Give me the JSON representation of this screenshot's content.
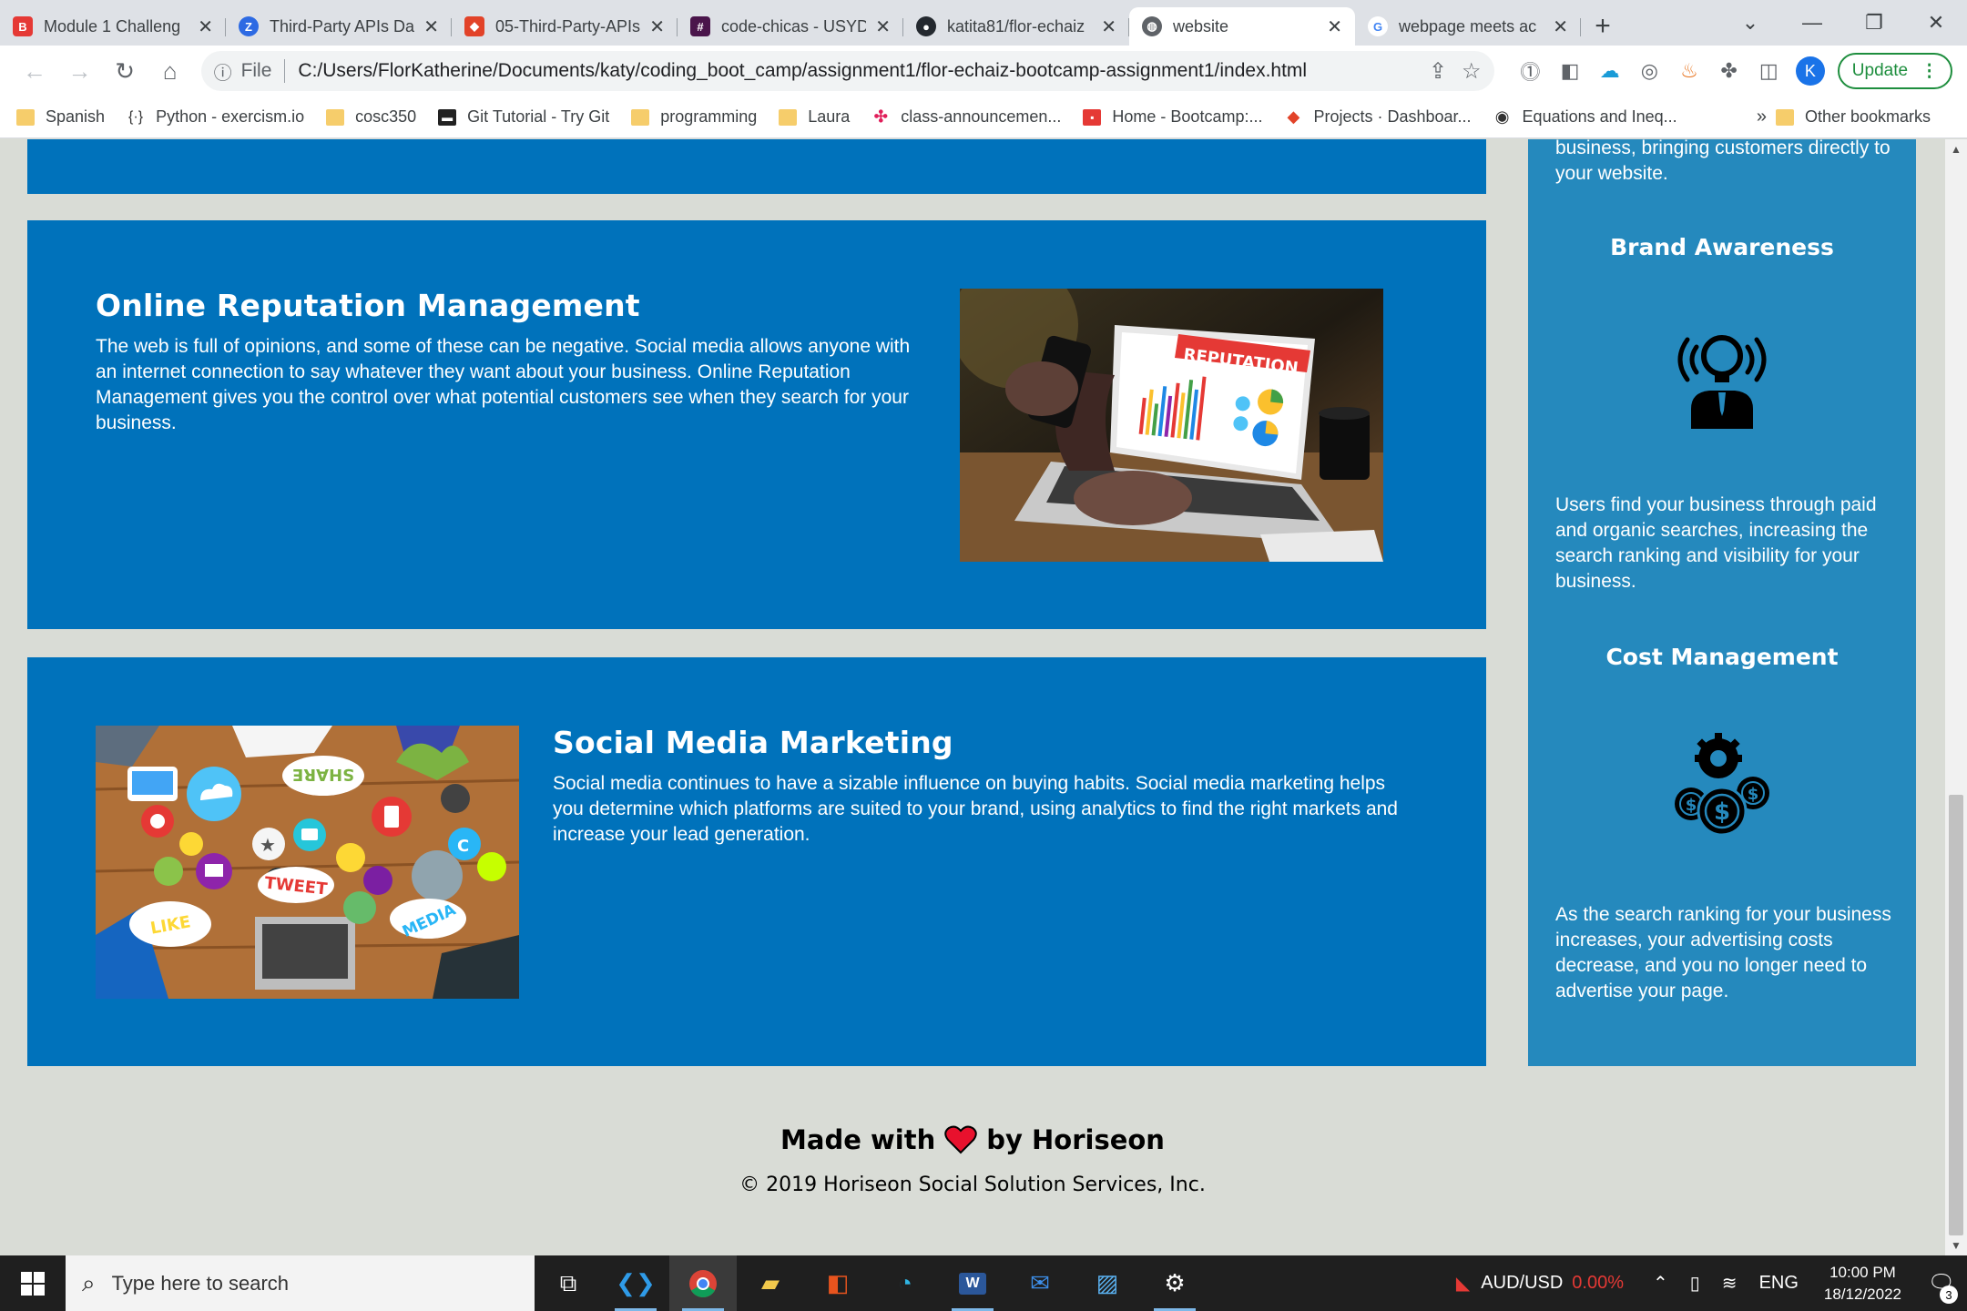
{
  "browser": {
    "tabs": [
      {
        "title": "Module 1 Challeng",
        "favicon_color": "#e53935",
        "favicon_text": "B"
      },
      {
        "title": "Third-Party APIs Da",
        "favicon_color": "#2d6ae3",
        "favicon_text": "Z"
      },
      {
        "title": "05-Third-Party-APIs",
        "favicon_color": "#e24329",
        "favicon_text": "◆"
      },
      {
        "title": "code-chicas - USYD",
        "favicon_color": "#4a154b",
        "favicon_text": "#"
      },
      {
        "title": "katita81/flor-echaiz",
        "favicon_color": "#24292f",
        "favicon_text": "●"
      },
      {
        "title": "website",
        "favicon_color": "#5f6368",
        "favicon_text": "◍"
      },
      {
        "title": "webpage meets ac",
        "favicon_color": "#ffffff",
        "favicon_text": "G"
      }
    ],
    "active_tab": 5,
    "new_tab_symbol": "+",
    "url_scheme_label": "File",
    "url": "C:/Users/FlorKatherine/Documents/katy/coding_boot_camp/assignment1/flor-echaiz-bootcamp-assignment1/index.html",
    "profile_initial": "K",
    "update_label": "Update",
    "bookmarks": [
      {
        "label": "Spanish",
        "icon": "folder"
      },
      {
        "label": "Python - exercism.io",
        "icon": "code-icon"
      },
      {
        "label": "cosc350",
        "icon": "folder"
      },
      {
        "label": "Git Tutorial - Try Git",
        "icon": "git-icon"
      },
      {
        "label": "programming",
        "icon": "folder"
      },
      {
        "label": "Laura",
        "icon": "folder"
      },
      {
        "label": "class-announcemen...",
        "icon": "slack-icon"
      },
      {
        "label": "Home - Bootcamp:...",
        "icon": "bootcamp-icon"
      },
      {
        "label": "Projects · Dashboar...",
        "icon": "gitlab-icon"
      },
      {
        "label": "Equations and Ineq...",
        "icon": "circle-icon"
      }
    ],
    "bookmarks_more": "»",
    "other_bookmarks": "Other bookmarks"
  },
  "page": {
    "colors": {
      "content_bg": "#0072bb",
      "sidebar_bg": "#2589bd",
      "page_bg": "#d9dcd6"
    },
    "reputation": {
      "heading": "Online Reputation Management",
      "text": "The web is full of opinions, and some of these can be negative. Social media allows anyone with an internet connection to say whatever they want about your business. Online Reputation Management gives you the control over what potential customers see when they search for your business.",
      "image_label": "REPUTATION"
    },
    "social": {
      "heading": "Social Media Marketing",
      "text": "Social media continues to have a sizable influence on buying habits. Social media marketing helps you determine which platforms are suited to your brand, using analytics to find the right markets and increase your lead generation.",
      "image_words": [
        "SHARE",
        "TWEET",
        "LIKE",
        "MEDIA"
      ]
    },
    "sidebar": {
      "top_text": "business, bringing customers directly to your website.",
      "brand": {
        "heading": "Brand Awareness",
        "icon": "lightbulb-person-icon",
        "text": "Users find your business through paid and organic searches, increasing the search ranking and visibility for your business."
      },
      "cost": {
        "heading": "Cost Management",
        "icon": "money-gear-icon",
        "text": "As the search ranking for your business increases, your advertising costs decrease, and you no longer need to advertise your page."
      }
    },
    "footer": {
      "made_with": "Made with",
      "by": "by Horiseon",
      "copyright": "© 2019 Horiseon Social Solution Services, Inc."
    }
  },
  "taskbar": {
    "search_placeholder": "Type here to search",
    "apps": [
      "task-view-icon",
      "vscode-icon",
      "chrome-icon",
      "file-explorer-icon",
      "office-icon",
      "edge-icon",
      "word-icon",
      "mail-icon",
      "photos-icon",
      "settings-icon"
    ],
    "ticker_label": "AUD/USD",
    "ticker_value": "0.00%",
    "language": "ENG",
    "time": "10:00 PM",
    "date": "18/12/2022",
    "notification_count": "3"
  }
}
